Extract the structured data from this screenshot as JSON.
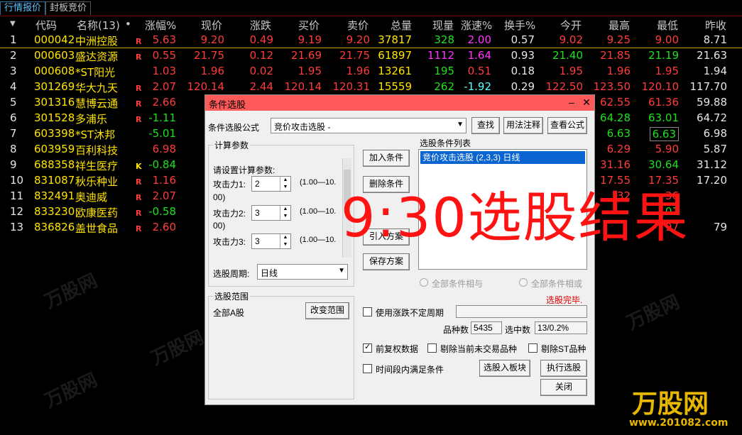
{
  "tabs": [
    "行情报价",
    "封板竞价"
  ],
  "columns": {
    "code": "代码",
    "name": "名称(13)",
    "dot": "•",
    "pct": "涨幅%",
    "price": "现价",
    "chg": "涨跌",
    "bid": "买价",
    "ask": "卖价",
    "vol": "总量",
    "cur": "现量",
    "speed": "涨速%",
    "turn": "换手%",
    "open": "今开",
    "high": "最高",
    "low": "最低",
    "prev": "昨收"
  },
  "rows": [
    {
      "idx": "1",
      "code": "000042",
      "name": "中洲控股",
      "flag": "R",
      "pct": "5.63",
      "price": "9.20",
      "chg": "0.49",
      "bid": "9.19",
      "ask": "9.20",
      "vol": "37817",
      "cur": "328",
      "speed": "2.00",
      "turn": "0.57",
      "open": "9.02",
      "high": "9.25",
      "low": "9.00",
      "prev": "8.71"
    },
    {
      "idx": "2",
      "code": "000603",
      "name": "盛达资源",
      "flag": "R",
      "pct": "0.55",
      "price": "21.75",
      "chg": "0.12",
      "bid": "21.69",
      "ask": "21.75",
      "vol": "61897",
      "cur": "1112",
      "speed": "1.64",
      "turn": "0.93",
      "open": "21.40",
      "high": "21.85",
      "low": "21.19",
      "prev": "21.63"
    },
    {
      "idx": "3",
      "code": "000608",
      "name": "*ST阳光",
      "flag": "",
      "pct": "1.03",
      "price": "1.96",
      "chg": "0.02",
      "bid": "1.95",
      "ask": "1.96",
      "vol": "13261",
      "cur": "195",
      "speed": "0.51",
      "turn": "0.18",
      "open": "1.95",
      "high": "1.96",
      "low": "1.95",
      "prev": "1.94"
    },
    {
      "idx": "4",
      "code": "301269",
      "name": "华大九天",
      "flag": "R",
      "pct": "2.07",
      "price": "120.14",
      "chg": "2.44",
      "bid": "120.14",
      "ask": "120.31",
      "vol": "15559",
      "cur": "262",
      "speed": "-1.92",
      "turn": "0.29",
      "open": "122.50",
      "high": "123.50",
      "low": "120.10",
      "prev": "117.70"
    },
    {
      "idx": "5",
      "code": "301316",
      "name": "慧博云通",
      "flag": "R",
      "pct": "2.66",
      "price": "6",
      "high": "62.55",
      "low": "61.36",
      "prev": "59.88"
    },
    {
      "idx": "6",
      "code": "301528",
      "name": "多浦乐",
      "flag": "R",
      "pct": "-1.11",
      "price": "6",
      "high": "64.28",
      "low": "63.01",
      "prev": "64.72"
    },
    {
      "idx": "7",
      "code": "603398",
      "name": "*ST沐邦",
      "flag": "",
      "pct": "-5.01",
      "price": "",
      "high": "6.63",
      "low": "6.63",
      "prev": "6.98"
    },
    {
      "idx": "8",
      "code": "603959",
      "name": "百利科技",
      "flag": "",
      "pct": "6.98",
      "price": "",
      "high": "6.29",
      "low": "5.90",
      "prev": "5.87"
    },
    {
      "idx": "9",
      "code": "688358",
      "name": "祥生医疗",
      "flag": "K",
      "pct": "-0.84",
      "price": "3",
      "high": "31.16",
      "low": "30.64",
      "prev": "31.12"
    },
    {
      "idx": "10",
      "code": "831087",
      "name": "秋乐种业",
      "flag": "R",
      "pct": "1.16",
      "price": "1",
      "high": "17.55",
      "low": "17.35",
      "prev": "17.20"
    },
    {
      "idx": "11",
      "code": "832491",
      "name": "奥迪威",
      "flag": "R",
      "pct": "2.07",
      "price": "3",
      "high": "32",
      "low": "36",
      "prev": ""
    },
    {
      "idx": "12",
      "code": "833230",
      "name": "欧康医药",
      "flag": "R",
      "pct": "-0.58",
      "price": "1",
      "high": "",
      "low": "01",
      "prev": ""
    },
    {
      "idx": "13",
      "code": "836826",
      "name": "盖世食品",
      "flag": "R",
      "pct": "2.60",
      "price": "1",
      "high": "",
      "low": "97",
      "prev": "79"
    }
  ],
  "dialog": {
    "title": "条件选股",
    "formula_label": "条件选股公式",
    "formula_value": "竞价攻击选股  -",
    "find": "查找",
    "usage": "用法注释",
    "view": "查看公式",
    "params_group": "计算参数",
    "params_prompt": "请设置计算参数:",
    "params": [
      {
        "label": "攻击力1:",
        "value": "2",
        "range": "(1.00—10.",
        "tail": "00)"
      },
      {
        "label": "攻击力2:",
        "value": "3",
        "range": "(1.00—10.",
        "tail": "00)"
      },
      {
        "label": "攻击力3:",
        "value": "3",
        "range": "(1.00—10.",
        "tail": ""
      }
    ],
    "add": "加入条件",
    "remove": "删除条件",
    "import": "引入方案",
    "save": "保存方案",
    "cond_list_label": "选股条件列表",
    "cond_item": "竞价攻击选股 (2,3,3) 日线",
    "period_label": "选股周期:",
    "period_value": "日线",
    "and_label": "全部条件相与",
    "or_label": "全部条件相或",
    "done": "选股完毕.",
    "range_group": "选股范围",
    "range_value": "全部A股",
    "change_range": "改变范围",
    "use_period": "使用涨跌不定周期",
    "count_label": "品种数",
    "count_value": "5435",
    "hit_label": "选中数",
    "hit_value": "13/0.2%",
    "fq": "前复权数据",
    "exclude_untraded": "剔除当前未交易品种",
    "exclude_st": "剔除ST品种",
    "time_cond": "时间段内满足条件",
    "to_block": "选股入板块",
    "run": "执行选股",
    "close": "关闭"
  },
  "overlay_text": "9:30选股结果",
  "watermark": {
    "name": "万股网",
    "url": "www.201082.com"
  }
}
